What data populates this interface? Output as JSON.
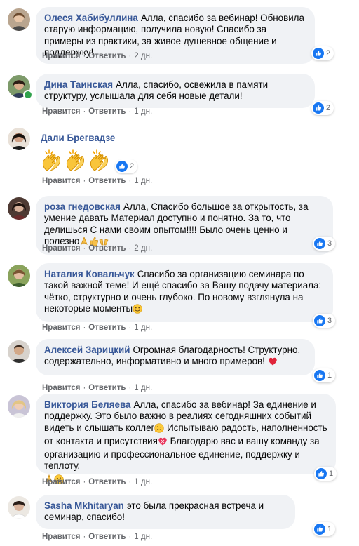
{
  "actions": {
    "like": "Нравится",
    "reply": "Ответить",
    "dot": "·"
  },
  "colors": {
    "author": "#385898",
    "bubble": "#f0f2f5",
    "meta": "#65676b",
    "like_blue": "#1877f2",
    "online": "#31a24c"
  },
  "comments": [
    {
      "author": "Олеся Хабибуллина",
      "text": "Алла, спасибо за вебинар! Обновила старую информацию, получила новую! Спасибо за примеры из практики, за живое душевное общение и поддержку!",
      "time": "2 дн.",
      "reactions": "2",
      "reaction_icon": "like-icon"
    },
    {
      "author": "Дина Таинская",
      "text": "Алла, спасибо, освежила в памяти структуру, услышала для себя новые детали!",
      "time": "1 дн.",
      "reactions": "2",
      "reaction_icon": "like-icon",
      "online": true
    },
    {
      "author": "Дали Брегвадзе",
      "text": "",
      "emoji": [
        "clapping-hands-emoji",
        "clapping-hands-emoji",
        "clapping-hands-emoji"
      ],
      "time": "1 дн.",
      "reactions": "2",
      "reaction_icon": "like-icon"
    },
    {
      "author": "роза гнедовская",
      "text": "Алла, Спасибо большое за открытость, за умение давать Материал доступно и понятно. За то, что делишься С нами своим опытом!!!! Было очень ценно и полезно",
      "trailing_emoji": [
        "folded-hands-emoji",
        "thumbs-up-emoji",
        "raising-hands-emoji"
      ],
      "time": "2 дн.",
      "reactions": "3",
      "reaction_icon": "like-icon"
    },
    {
      "author": "Наталия Ковальчук",
      "text": "Спасибо за организацию семинара по такой важной теме! И ещё спасибо за Вашу подачу материала: чётко, структурно и очень глубоко. По новому взглянула на некоторые моменты",
      "trailing_emoji": [
        "smiling-face-emoji"
      ],
      "time": "1 дн.",
      "reactions": "3",
      "reaction_icon": "like-icon"
    },
    {
      "author": "Алексей Зарицкий",
      "text": "Огромная благодарность! Структурно, содержательно, информативно и много примеров!",
      "trailing_emoji": [
        "red-heart-emoji"
      ],
      "time": "1 дн.",
      "reactions": "1",
      "reaction_icon": "like-icon"
    },
    {
      "author": "Виктория Беляева",
      "text": "Алла, спасибо за вебинар! За единение и поддержку. Это было важно в реалиях сегодняшних событий видеть и слышать коллег",
      "text2": " Испытываю радость, наполненность от контакта и присутствия",
      "text3": " Благодарю вас и вашу команду за организацию и профессиональное единение, поддержку и теплоту.",
      "time": "1 дн.",
      "reactions": "1",
      "reaction_icon": "like-icon"
    },
    {
      "author": "Sasha Mkhitaryan",
      "text": "это была прекрасная встреча и семинар, спасибо!",
      "time": "1 дн.",
      "reactions": "1",
      "reaction_icon": "like-icon"
    }
  ]
}
